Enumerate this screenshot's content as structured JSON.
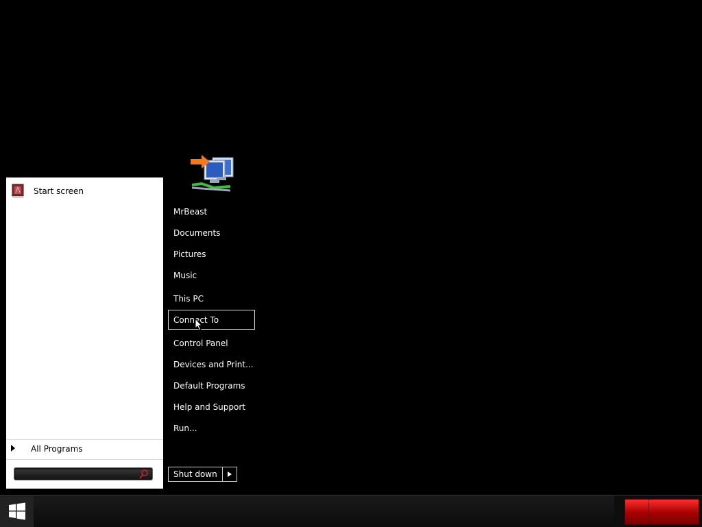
{
  "start_menu": {
    "pinned": [
      {
        "label": "Start screen",
        "icon": "start-screen-tile-icon"
      }
    ],
    "all_programs_label": "All Programs",
    "search_placeholder": ""
  },
  "right_column": {
    "user_icon": "network-connect-icon",
    "items": [
      {
        "label": "MrBeast"
      },
      {
        "label": "Documents"
      },
      {
        "label": "Pictures"
      },
      {
        "label": "Music"
      },
      {
        "label": "This PC"
      },
      {
        "label": "Connect To"
      },
      {
        "label": "Control Panel"
      },
      {
        "label": "Devices and Print..."
      },
      {
        "label": "Default Programs"
      },
      {
        "label": "Help and Support"
      },
      {
        "label": "Run..."
      }
    ],
    "highlighted_item": "Connect To"
  },
  "shutdown": {
    "label": "Shut down"
  },
  "taskbar": {
    "start_icon": "windows-logo-icon",
    "tray_color": "#d00000"
  }
}
